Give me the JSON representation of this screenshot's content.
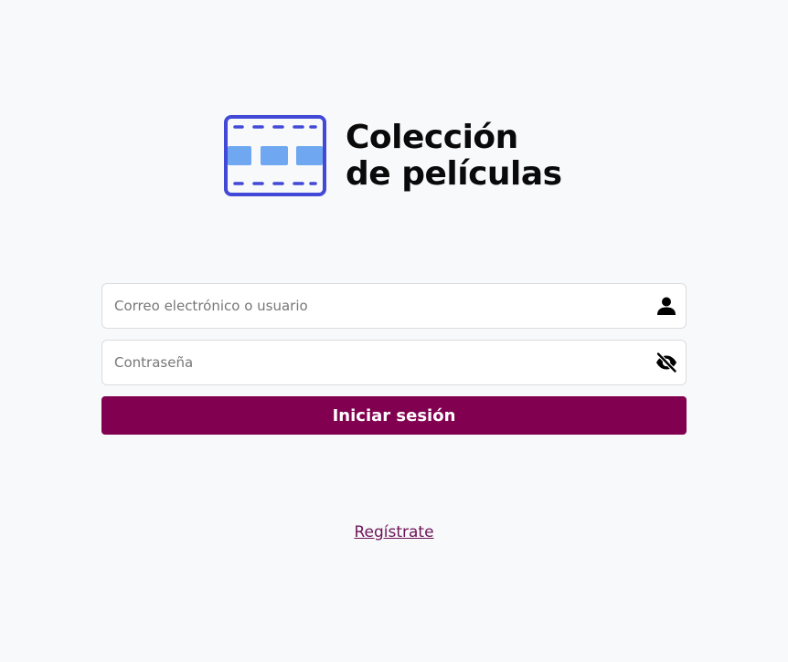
{
  "brand": {
    "title_line1": "Colección",
    "title_line2": "de películas",
    "icon": "film-strip-icon",
    "colors": {
      "frame": "#4149d6",
      "cells": "#6fa8f0"
    }
  },
  "login_form": {
    "user_field": {
      "placeholder": "Correo electrónico o usuario",
      "value": "",
      "icon": "user-icon"
    },
    "password_field": {
      "placeholder": "Contraseña",
      "value": "",
      "icon": "eye-slash-icon"
    },
    "submit_label": "Iniciar sesión",
    "submit_color": "#820050"
  },
  "register_link": {
    "label": "Regístrate"
  }
}
